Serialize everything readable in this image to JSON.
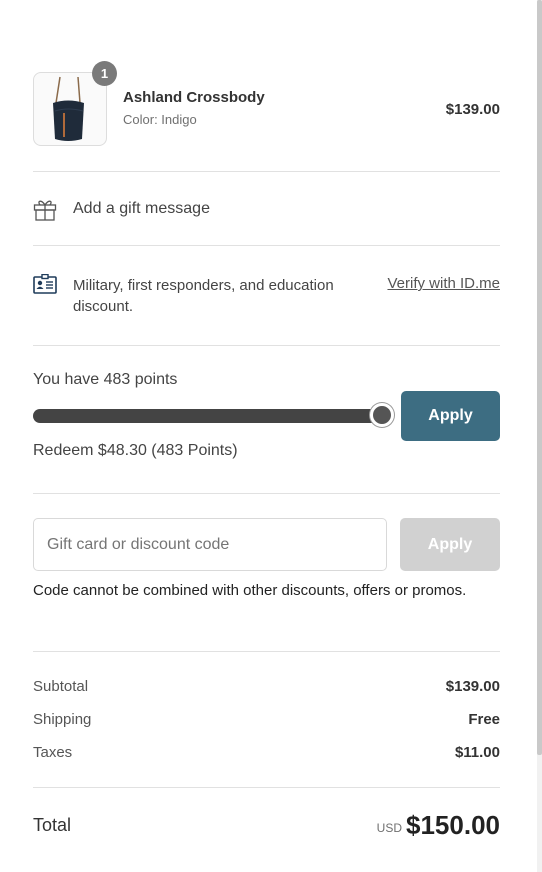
{
  "product": {
    "quantity": "1",
    "name": "Ashland Crossbody",
    "variant": "Color: Indigo",
    "price": "$139.00",
    "image_icon": "handbag-image"
  },
  "gift": {
    "icon": "gift-icon",
    "label": "Add a gift message"
  },
  "military": {
    "icon": "id-card-icon",
    "text": "Military, first responders, and education discount.",
    "link": "Verify with ID.me"
  },
  "points": {
    "label": "You have 483 points",
    "slider_fraction": 1.0,
    "apply_label": "Apply",
    "redeem_text": "Redeem $48.30 (483 Points)",
    "accent_color": "#3d6d82"
  },
  "discount": {
    "placeholder": "Gift card or discount code",
    "value": "",
    "apply_label": "Apply",
    "note": "Code cannot be combined with other discounts, offers or promos."
  },
  "summary": {
    "subtotal_label": "Subtotal",
    "subtotal_value": "$139.00",
    "shipping_label": "Shipping",
    "shipping_value": "Free",
    "taxes_label": "Taxes",
    "taxes_value": "$11.00",
    "total_label": "Total",
    "currency": "USD",
    "total_value": "$150.00"
  }
}
